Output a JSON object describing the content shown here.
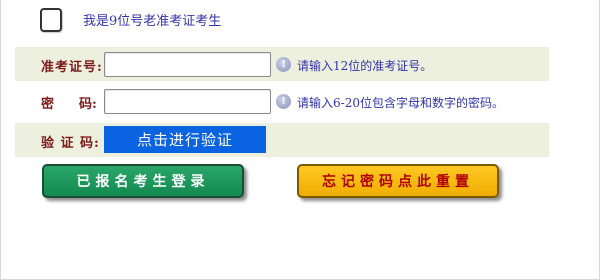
{
  "old_candidate": {
    "checked": false,
    "label": "我是9位号老准考证考生"
  },
  "ticket": {
    "label": "准考证号:",
    "value": "",
    "hint": "请输入12位的准考证号。"
  },
  "password": {
    "label_part1": "密",
    "label_part2": "码:",
    "value": "",
    "hint": "请输入6-20位包含字母和数字的密码。"
  },
  "captcha": {
    "label": "验 证 码:",
    "button_label": "点击进行验证"
  },
  "actions": {
    "login_label": "已报名考生登录",
    "reset_label": "忘记密码点此重置"
  },
  "colors": {
    "label_text": "#7a1a1a",
    "hint_text": "#3333aa",
    "row_shade": "#eef0df",
    "verify_blue": "#0a63e0",
    "login_green": "#1e9a5c",
    "reset_yellow": "#f8bb14",
    "reset_text": "#b00000"
  }
}
